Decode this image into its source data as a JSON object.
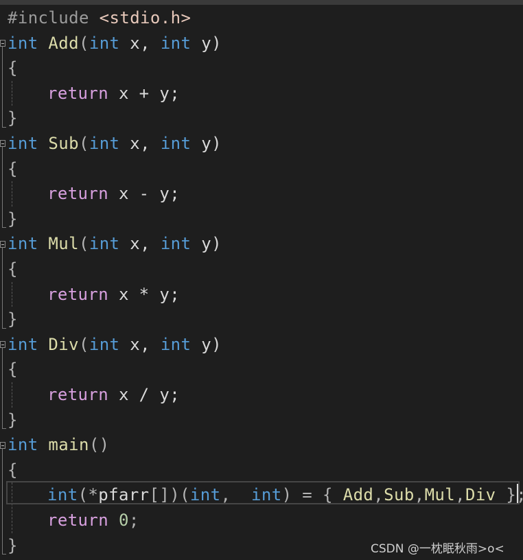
{
  "editor": {
    "lines": [
      {
        "tokens": [
          {
            "t": "#include ",
            "c": "pre"
          },
          {
            "t": "<stdio.h>",
            "c": "inc"
          }
        ]
      },
      {
        "tokens": [
          {
            "t": "int",
            "c": "kw"
          },
          {
            "t": " ",
            "c": "id"
          },
          {
            "t": "Add",
            "c": "fn"
          },
          {
            "t": "(",
            "c": "pun"
          },
          {
            "t": "int",
            "c": "kw"
          },
          {
            "t": " x, ",
            "c": "id"
          },
          {
            "t": "int",
            "c": "kw"
          },
          {
            "t": " y)",
            "c": "id"
          }
        ]
      },
      {
        "tokens": [
          {
            "t": "{",
            "c": "pun"
          }
        ]
      },
      {
        "indent": true,
        "tokens": [
          {
            "t": "return",
            "c": "ctrl"
          },
          {
            "t": " x + y;",
            "c": "id"
          }
        ]
      },
      {
        "tokens": [
          {
            "t": "}",
            "c": "pun"
          }
        ]
      },
      {
        "tokens": [
          {
            "t": "int",
            "c": "kw"
          },
          {
            "t": " ",
            "c": "id"
          },
          {
            "t": "Sub",
            "c": "fn"
          },
          {
            "t": "(",
            "c": "pun"
          },
          {
            "t": "int",
            "c": "kw"
          },
          {
            "t": " x, ",
            "c": "id"
          },
          {
            "t": "int",
            "c": "kw"
          },
          {
            "t": " y)",
            "c": "id"
          }
        ]
      },
      {
        "tokens": [
          {
            "t": "{",
            "c": "pun"
          }
        ]
      },
      {
        "indent": true,
        "tokens": [
          {
            "t": "return",
            "c": "ctrl"
          },
          {
            "t": " x - y;",
            "c": "id"
          }
        ]
      },
      {
        "tokens": [
          {
            "t": "}",
            "c": "pun"
          }
        ]
      },
      {
        "tokens": [
          {
            "t": "int",
            "c": "kw"
          },
          {
            "t": " ",
            "c": "id"
          },
          {
            "t": "Mul",
            "c": "fn"
          },
          {
            "t": "(",
            "c": "pun"
          },
          {
            "t": "int",
            "c": "kw"
          },
          {
            "t": " x, ",
            "c": "id"
          },
          {
            "t": "int",
            "c": "kw"
          },
          {
            "t": " y)",
            "c": "id"
          }
        ]
      },
      {
        "tokens": [
          {
            "t": "{",
            "c": "pun"
          }
        ]
      },
      {
        "indent": true,
        "tokens": [
          {
            "t": "return",
            "c": "ctrl"
          },
          {
            "t": " x * y;",
            "c": "id"
          }
        ]
      },
      {
        "tokens": [
          {
            "t": "}",
            "c": "pun"
          }
        ]
      },
      {
        "tokens": [
          {
            "t": "int",
            "c": "kw"
          },
          {
            "t": " ",
            "c": "id"
          },
          {
            "t": "Div",
            "c": "fn"
          },
          {
            "t": "(",
            "c": "pun"
          },
          {
            "t": "int",
            "c": "kw"
          },
          {
            "t": " x, ",
            "c": "id"
          },
          {
            "t": "int",
            "c": "kw"
          },
          {
            "t": " y)",
            "c": "id"
          }
        ]
      },
      {
        "tokens": [
          {
            "t": "{",
            "c": "pun"
          }
        ]
      },
      {
        "indent": true,
        "tokens": [
          {
            "t": "return",
            "c": "ctrl"
          },
          {
            "t": " x / y;",
            "c": "id"
          }
        ]
      },
      {
        "tokens": [
          {
            "t": "}",
            "c": "pun"
          }
        ]
      },
      {
        "tokens": [
          {
            "t": "int",
            "c": "kw"
          },
          {
            "t": " ",
            "c": "id"
          },
          {
            "t": "main",
            "c": "fn"
          },
          {
            "t": "()",
            "c": "pun"
          }
        ]
      },
      {
        "tokens": [
          {
            "t": "{",
            "c": "pun"
          }
        ]
      },
      {
        "indent": true,
        "tokens": [
          {
            "t": "int",
            "c": "kw"
          },
          {
            "t": "(*",
            "c": "pun"
          },
          {
            "t": "pfarr",
            "c": "id"
          },
          {
            "t": "[])(",
            "c": "pun"
          },
          {
            "t": "int",
            "c": "kw"
          },
          {
            "t": ",  ",
            "c": "pun"
          },
          {
            "t": "int",
            "c": "kw"
          },
          {
            "t": ") = { ",
            "c": "pun"
          },
          {
            "t": "Add",
            "c": "fn"
          },
          {
            "t": ",",
            "c": "pun"
          },
          {
            "t": "Sub",
            "c": "fn"
          },
          {
            "t": ",",
            "c": "pun"
          },
          {
            "t": "Mul",
            "c": "fn"
          },
          {
            "t": ",",
            "c": "pun"
          },
          {
            "t": "Div",
            "c": "fn"
          },
          {
            "t": " };",
            "c": "pun"
          }
        ]
      },
      {
        "indent": true,
        "tokens": [
          {
            "t": "return",
            "c": "ctrl"
          },
          {
            "t": " ",
            "c": "id"
          },
          {
            "t": "0",
            "c": "num"
          },
          {
            "t": ";",
            "c": "pun"
          }
        ]
      },
      {
        "tokens": [
          {
            "t": "}",
            "c": "pun"
          }
        ]
      }
    ]
  },
  "watermark": {
    "text": "CSDN @一枕眠秋雨>o<"
  },
  "colors": {
    "background": "#1e1e1e",
    "keyword": "#569cd6",
    "control": "#d8a0df",
    "function": "#dcdcaa",
    "identifier": "#dadada"
  }
}
